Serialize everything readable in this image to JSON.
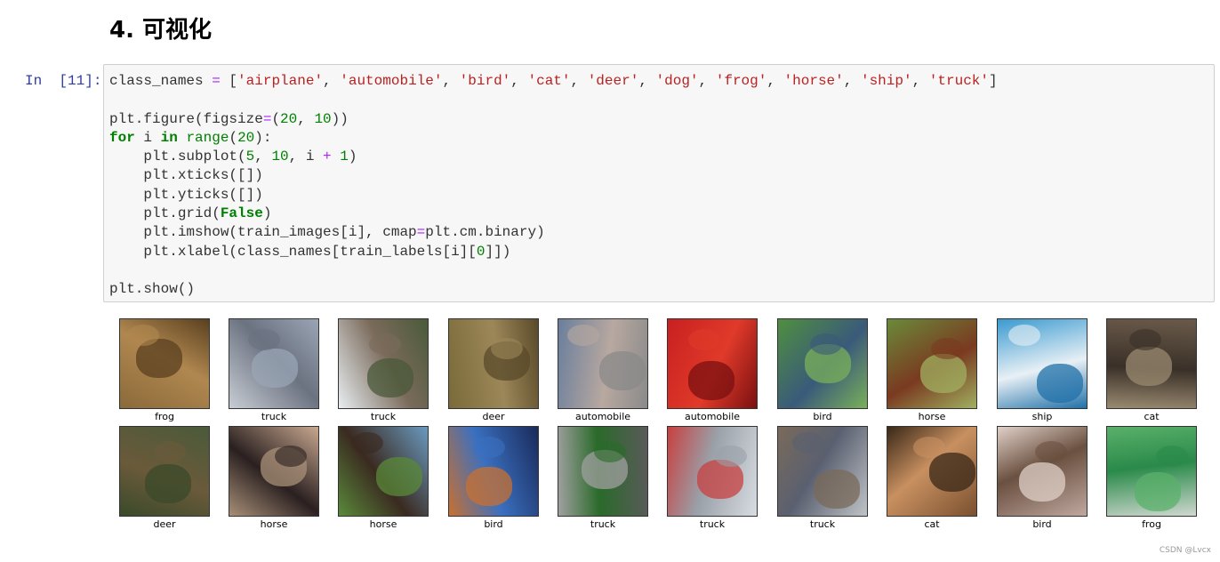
{
  "heading": "4. 可视化",
  "prompt": "In  [11]:",
  "code": {
    "line1": "class_names = ['airplane', 'automobile', 'bird', 'cat', 'deer', 'dog', 'frog', 'horse', 'ship', 'truck']",
    "line3": "plt.figure(figsize=(20, 10))",
    "line4": "for i in range(20):",
    "line5": "    plt.subplot(5, 10, i + 1)",
    "line6": "    plt.xticks([])",
    "line7": "    plt.yticks([])",
    "line8": "    plt.grid(False)",
    "line9": "    plt.imshow(train_images[i], cmap=plt.cm.binary)",
    "line10": "    plt.xlabel(class_names[train_labels[i][0]])",
    "line12": "plt.show()"
  },
  "images": [
    {
      "label": "frog",
      "colors": [
        "#8a6a3a",
        "#b0874f",
        "#5a4020"
      ]
    },
    {
      "label": "truck",
      "colors": [
        "#c8cdd4",
        "#6b7280",
        "#9aa5b5"
      ]
    },
    {
      "label": "truck",
      "colors": [
        "#e8eef2",
        "#7a6a5a",
        "#4a5a3a"
      ]
    },
    {
      "label": "deer",
      "colors": [
        "#7a6a3a",
        "#9c8758",
        "#5a4a2a"
      ]
    },
    {
      "label": "automobile",
      "colors": [
        "#6a7f9c",
        "#b8a8a0",
        "#8a8a8a"
      ]
    },
    {
      "label": "automobile",
      "colors": [
        "#c82020",
        "#e03a2a",
        "#7a1010"
      ]
    },
    {
      "label": "bird",
      "colors": [
        "#4f8f3f",
        "#3a5a7a",
        "#7ab05a"
      ]
    },
    {
      "label": "horse",
      "colors": [
        "#6a8a3a",
        "#7a3a20",
        "#a0b060"
      ]
    },
    {
      "label": "ship",
      "colors": [
        "#3a9ad0",
        "#e8f0f5",
        "#2070a8"
      ]
    },
    {
      "label": "cat",
      "colors": [
        "#6a5a4a",
        "#3a3028",
        "#9a8a70"
      ]
    },
    {
      "label": "deer",
      "colors": [
        "#4a5a3a",
        "#6a5a3a",
        "#3a4a2a"
      ]
    },
    {
      "label": "horse",
      "colors": [
        "#c8a890",
        "#2a2020",
        "#a89078"
      ]
    },
    {
      "label": "horse",
      "colors": [
        "#6a9ac0",
        "#3a2a20",
        "#5a8a3a"
      ]
    },
    {
      "label": "bird",
      "colors": [
        "#1a2a5a",
        "#3a70c0",
        "#c87030"
      ]
    },
    {
      "label": "truck",
      "colors": [
        "#5a5a5a",
        "#2a6a2a",
        "#a0a0a0"
      ]
    },
    {
      "label": "truck",
      "colors": [
        "#d8dde2",
        "#9aa0a8",
        "#c84040"
      ]
    },
    {
      "label": "truck",
      "colors": [
        "#c0c4c8",
        "#5a6070",
        "#7a6a5a"
      ]
    },
    {
      "label": "cat",
      "colors": [
        "#7a5030",
        "#c89060",
        "#3a2818"
      ]
    },
    {
      "label": "bird",
      "colors": [
        "#c0a8a0",
        "#6a5040",
        "#e0d0c8"
      ]
    },
    {
      "label": "frog",
      "colors": [
        "#d0d8d0",
        "#2a8a4a",
        "#5ab06a"
      ]
    }
  ],
  "watermark": "CSDN @Lvcx"
}
